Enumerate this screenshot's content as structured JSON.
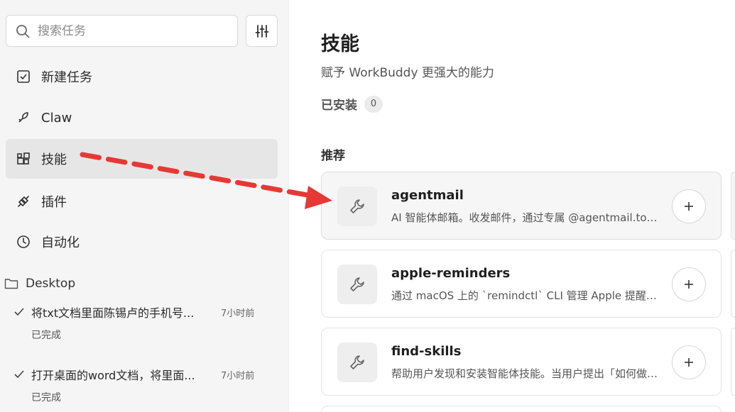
{
  "sidebar": {
    "search": {
      "placeholder": "搜索任务",
      "icon": "search-icon"
    },
    "filter_icon": "sliders-icon",
    "nav": [
      {
        "label": "新建任务",
        "icon": "checkbox-edit-icon"
      },
      {
        "label": "Claw",
        "icon": "claw-icon"
      },
      {
        "label": "技能",
        "icon": "blocks-icon",
        "active": true
      },
      {
        "label": "插件",
        "icon": "plug-icon"
      },
      {
        "label": "自动化",
        "icon": "clock-icon"
      }
    ],
    "folder": {
      "label": "Desktop",
      "icon": "folder-icon"
    },
    "tasks": [
      {
        "title": "将txt文档里面陈锡卢的手机号...",
        "time": "7小时前",
        "status": "已完成"
      },
      {
        "title": "打开桌面的word文档，将里面...",
        "time": "7小时前",
        "status": "已完成"
      }
    ]
  },
  "main": {
    "title": "技能",
    "subtitle": "赋予 WorkBuddy 更强大的能力",
    "installed": {
      "label": "已安装",
      "count": "0"
    },
    "recommended_label": "推荐",
    "skills": [
      {
        "name": "agentmail",
        "desc": "AI 智能体邮箱。收发邮件，通过专属 @agentmail.to 地址",
        "icon": "wrench-icon"
      },
      {
        "name": "apple-reminders",
        "desc": "通过 macOS 上的 `remindctl` CLI 管理 Apple 提醒事项",
        "icon": "wrench-icon"
      },
      {
        "name": "find-skills",
        "desc": "帮助用户发现和安装智能体技能。当用户提出「如何做某事」",
        "icon": "wrench-icon"
      }
    ]
  },
  "colors": {
    "annotation_arrow": "#e53935",
    "sidebar_bg": "#f5f5f5",
    "active_bg": "#e6e6e6"
  }
}
